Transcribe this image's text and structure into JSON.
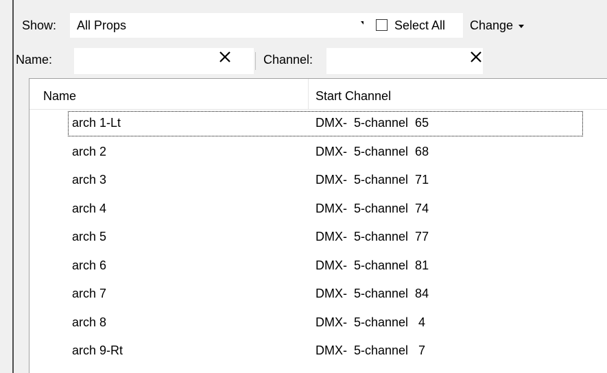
{
  "toolbar": {
    "show_label": "Show:",
    "show_value": "All Props",
    "select_all_label": "Select All",
    "select_all_checked": false,
    "change_label": "Change"
  },
  "filters": {
    "name_label": "Name:",
    "name_value": "",
    "channel_label": "Channel:",
    "channel_value": ""
  },
  "table": {
    "columns": [
      "Name",
      "Start Channel"
    ],
    "rows": [
      {
        "name": "arch 1-Lt",
        "channel": "DMX-  5-channel  65",
        "focused": true
      },
      {
        "name": "arch 2",
        "channel": "DMX-  5-channel  68",
        "focused": false
      },
      {
        "name": "arch 3",
        "channel": "DMX-  5-channel  71",
        "focused": false
      },
      {
        "name": "arch 4",
        "channel": "DMX-  5-channel  74",
        "focused": false
      },
      {
        "name": "arch 5",
        "channel": "DMX-  5-channel  77",
        "focused": false
      },
      {
        "name": "arch 6",
        "channel": "DMX-  5-channel  81",
        "focused": false
      },
      {
        "name": "arch 7",
        "channel": "DMX-  5-channel  84",
        "focused": false
      },
      {
        "name": "arch 8",
        "channel": "DMX-  5-channel   4",
        "focused": false
      },
      {
        "name": "arch 9-Rt",
        "channel": "DMX-  5-channel   7",
        "focused": false
      }
    ]
  }
}
